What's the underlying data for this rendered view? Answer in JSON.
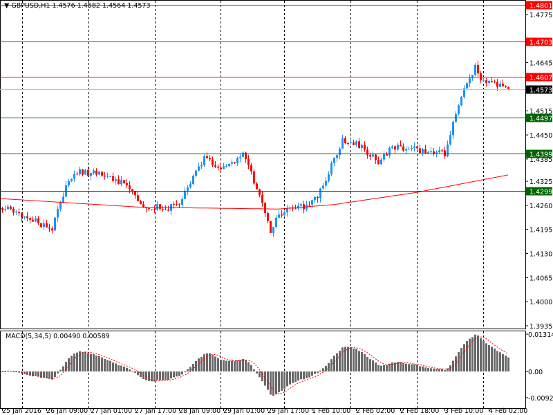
{
  "header": {
    "symbol_info": "GBPUSD,H1  1.4576 1.4582 1.4564 1.4573"
  },
  "macd_panel": {
    "label": "MACD(5,34,5) 0.00490 0.00589"
  },
  "colors": {
    "bull": "#1e90ff",
    "bear": "#ff0000",
    "resistance": "#ff0000",
    "support": "#006400",
    "bid": "#c0c0c0",
    "ma": "#ff0000",
    "histogram": "#696969",
    "signal": "#ff0000"
  },
  "chart_data": {
    "type": "candlestick",
    "title": "GBPUSD,H1",
    "ylim": [
      1.3935,
      1.4801
    ],
    "price_ticks": [
      "1.4775",
      "1.4645",
      "1.4515",
      "1.4450",
      "1.4385",
      "1.4325",
      "1.4260",
      "1.4195",
      "1.4130",
      "1.4065",
      "1.4000",
      "1.3935"
    ],
    "levels": [
      {
        "value": 1.4801,
        "label": "1.4801",
        "kind": "resistance"
      },
      {
        "value": 1.4703,
        "label": "1.4703",
        "kind": "resistance"
      },
      {
        "value": 1.4607,
        "label": "1.4607",
        "kind": "resistance"
      },
      {
        "value": 1.4573,
        "label": "1.4573",
        "kind": "bid"
      },
      {
        "value": 1.4497,
        "label": "1.4497",
        "kind": "support"
      },
      {
        "value": 1.4399,
        "label": "1.4399",
        "kind": "support"
      },
      {
        "value": 1.4299,
        "label": "1.4299",
        "kind": "support"
      }
    ],
    "bar_count": 184,
    "close_keypoints": [
      [
        0,
        1.4254
      ],
      [
        9,
        1.4226
      ],
      [
        18,
        1.4198
      ],
      [
        24,
        1.4329
      ],
      [
        28,
        1.4351
      ],
      [
        39,
        1.4338
      ],
      [
        47,
        1.4301
      ],
      [
        49,
        1.4264
      ],
      [
        59,
        1.425
      ],
      [
        64,
        1.4262
      ],
      [
        68,
        1.4319
      ],
      [
        73,
        1.4385
      ],
      [
        79,
        1.4357
      ],
      [
        87,
        1.4394
      ],
      [
        92,
        1.431
      ],
      [
        97,
        1.4189
      ],
      [
        100,
        1.4236
      ],
      [
        109,
        1.4258
      ],
      [
        114,
        1.4282
      ],
      [
        119,
        1.4366
      ],
      [
        123,
        1.4437
      ],
      [
        129,
        1.4422
      ],
      [
        136,
        1.4375
      ],
      [
        140,
        1.4413
      ],
      [
        147,
        1.4418
      ],
      [
        154,
        1.4403
      ],
      [
        160,
        1.44
      ],
      [
        164,
        1.4515
      ],
      [
        168,
        1.459
      ],
      [
        171,
        1.4633
      ],
      [
        174,
        1.459
      ],
      [
        179,
        1.4585
      ],
      [
        183,
        1.4573
      ]
    ],
    "ma_keypoints": [
      [
        0,
        1.4278
      ],
      [
        50,
        1.4255
      ],
      [
        100,
        1.425
      ],
      [
        120,
        1.4262
      ],
      [
        150,
        1.4295
      ],
      [
        183,
        1.4342
      ]
    ],
    "macd": {
      "fast": 5,
      "slow": 34,
      "signal": 5,
      "ylim": [
        -0.00921,
        0.01314
      ],
      "ticks": [
        "0.01314",
        "0.00",
        "-0.00921"
      ]
    },
    "time_labels": [
      "25 Jan 2016",
      "26 Jan 09:00",
      "27 Jan 01:00",
      "27 Jan 17:00",
      "28 Jan 09:00",
      "29 Jan 01:00",
      "29 Jan 17:00",
      "1 Feb 10:00",
      "2 Feb 02:00",
      "2 Feb 18:00",
      "3 Feb 10:00",
      "4 Feb 02:00"
    ]
  }
}
